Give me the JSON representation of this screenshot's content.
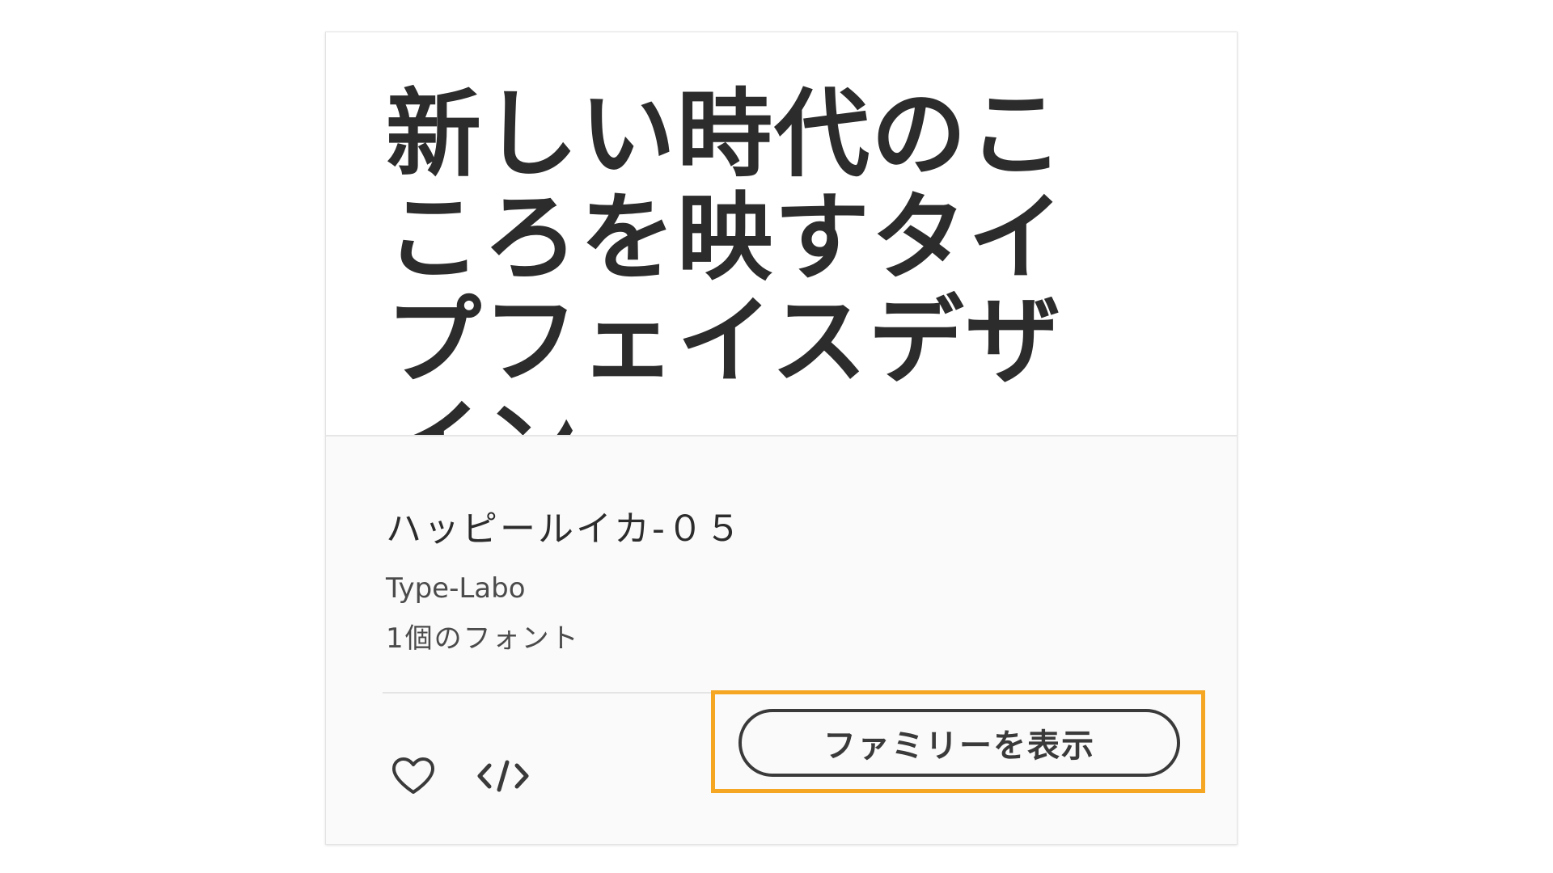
{
  "card": {
    "preview_text": "新しい時代のこころを映すタイプフェイスデザイン",
    "font_name": "ハッピールイカ-０５",
    "foundry": "Type-Labo",
    "font_count": "1個のフォント",
    "actions": {
      "favorite_icon": "heart-icon",
      "embed_icon": "code-embed-icon",
      "view_family_label": "ファミリーを表示"
    }
  },
  "colors": {
    "highlight": "#f5a623",
    "text": "#2c2c2c",
    "card_background": "#fafafa"
  }
}
